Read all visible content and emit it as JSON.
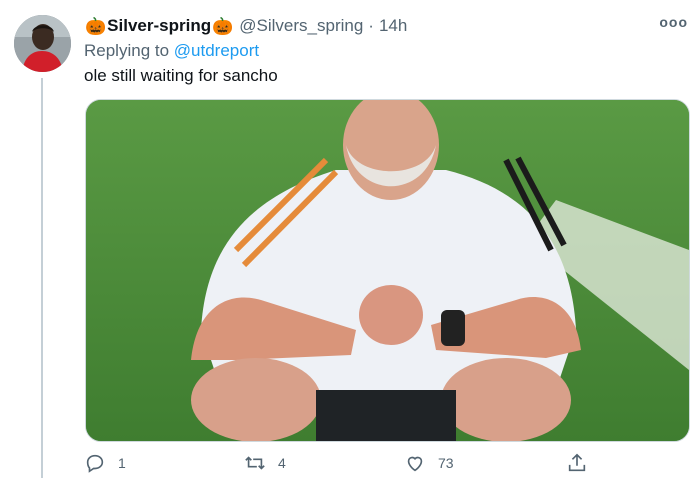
{
  "tweet": {
    "display_name": "Silver-spring",
    "name_emoji": "🎃",
    "handle": "@Silvers_spring",
    "separator": "·",
    "time": "14h",
    "replying_prefix": "Replying to ",
    "replying_to": "@utdreport",
    "text": "ole still waiting for sancho",
    "more_label": "ooo"
  },
  "actions": {
    "reply_count": "1",
    "retweet_count": "4",
    "like_count": "73"
  },
  "colors": {
    "link": "#1d9bf0",
    "secondary_text": "#536471",
    "thread_line": "#c4cfd6"
  },
  "icons": [
    "more-icon",
    "reply-icon",
    "retweet-icon",
    "like-icon",
    "share-icon"
  ]
}
